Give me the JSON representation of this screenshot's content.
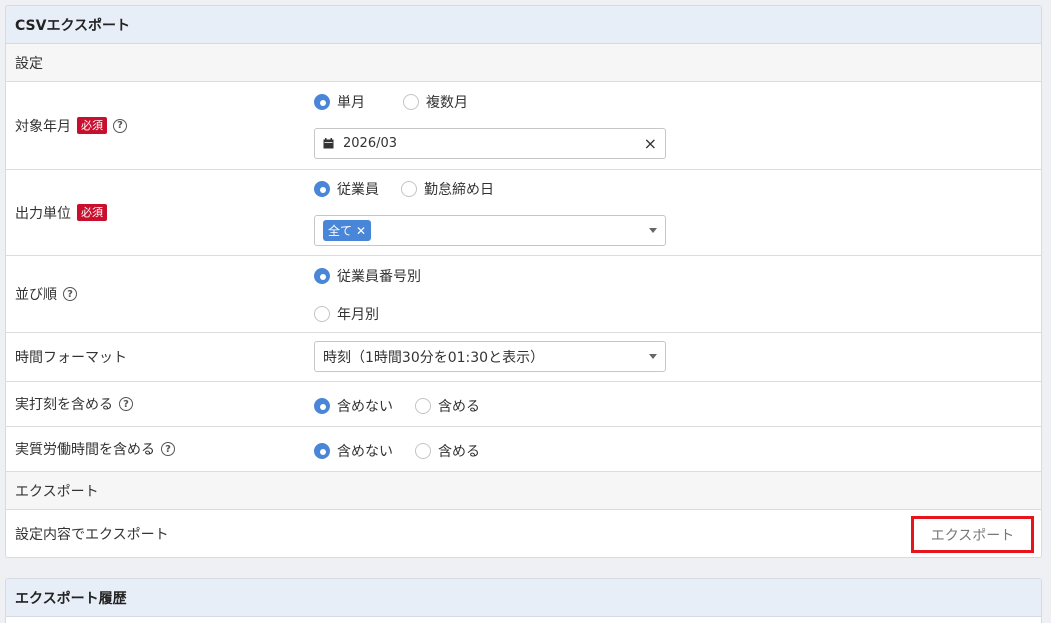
{
  "panel": {
    "title": "CSVエクスポート"
  },
  "settings": {
    "section_title": "設定"
  },
  "target_month": {
    "label": "対象年月",
    "required": "必須",
    "help": "?",
    "options": [
      "単月",
      "複数月"
    ],
    "selected_index": 0,
    "date_value": "2026/03",
    "clear_icon": "×"
  },
  "output_unit": {
    "label": "出力単位",
    "required": "必須",
    "options": [
      "従業員",
      "勤怠締め日"
    ],
    "selected_index": 0,
    "chip_label": "全て",
    "chip_remove": "✕"
  },
  "sort_order": {
    "label": "並び順",
    "help": "?",
    "options": [
      "従業員番号別",
      "年月別"
    ],
    "selected_index": 0
  },
  "time_format": {
    "label": "時間フォーマット",
    "value": "時刻（1時間30分を01:30と表示）"
  },
  "include_actual_stamp": {
    "label": "実打刻を含める",
    "help": "?",
    "options": [
      "含めない",
      "含める"
    ],
    "selected_index": 0
  },
  "include_actual_work": {
    "label": "実質労働時間を含める",
    "help": "?",
    "options": [
      "含めない",
      "含める"
    ],
    "selected_index": 0
  },
  "export": {
    "section_title": "エクスポート",
    "row_label": "設定内容でエクスポート",
    "button_label": "エクスポート"
  },
  "history": {
    "title": "エクスポート履歴"
  },
  "colors": {
    "accent": "#4a86d8",
    "required": "#c8102e",
    "highlight": "#e8141b",
    "header_bg": "#e8eef8"
  }
}
